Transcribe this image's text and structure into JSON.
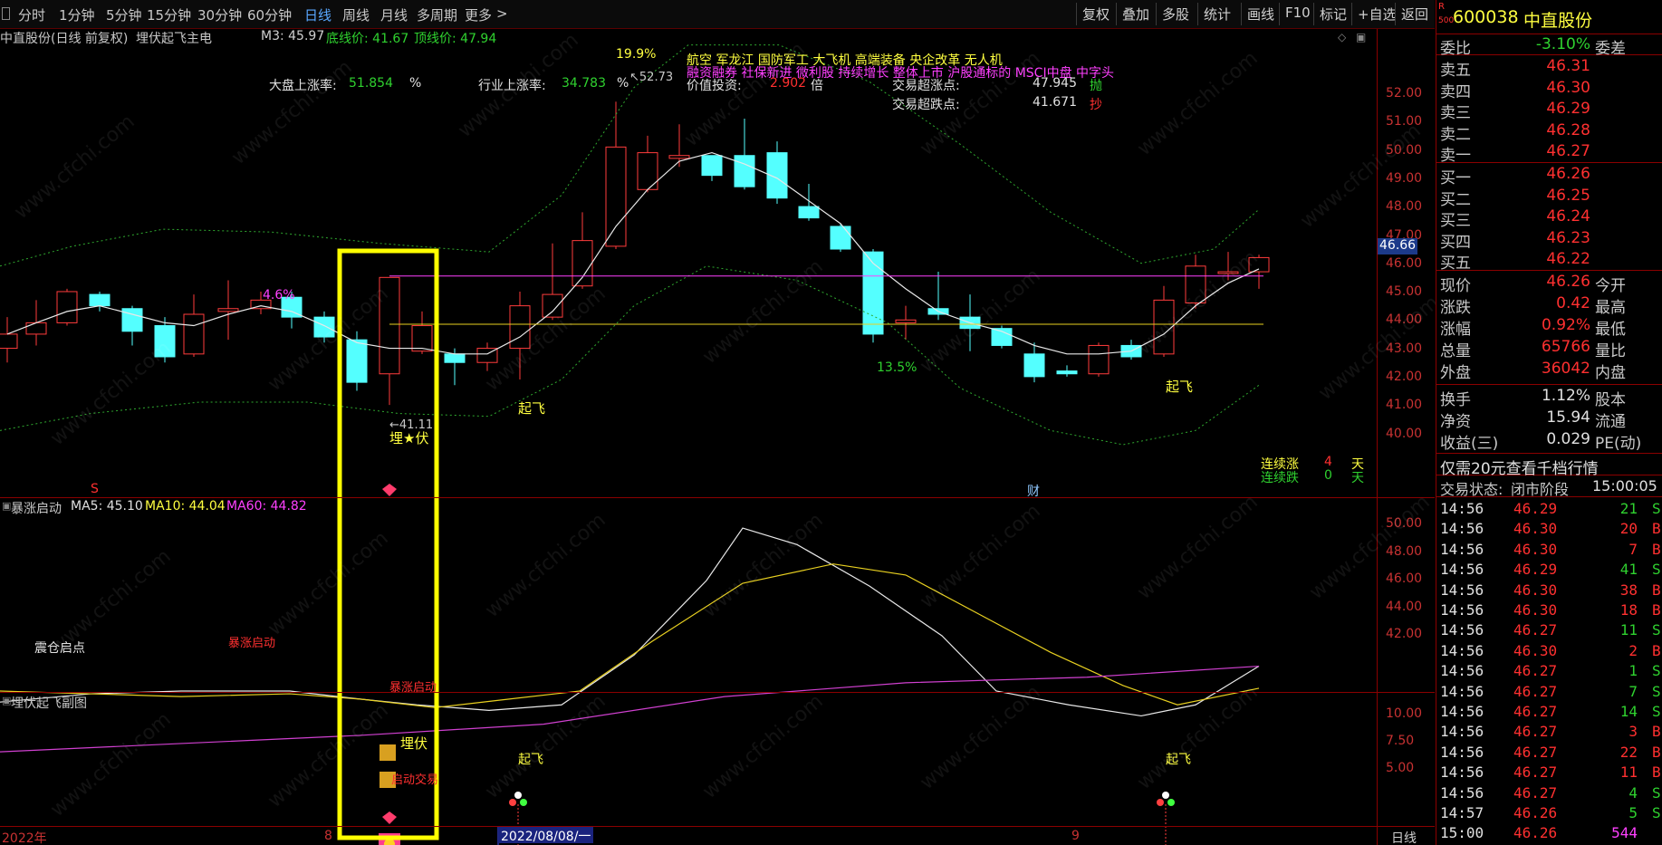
{
  "toolbar": {
    "periods": [
      "分时",
      "1分钟",
      "5分钟",
      "15分钟",
      "30分钟",
      "60分钟",
      "日线",
      "周线",
      "月线",
      "多周期",
      "更多"
    ],
    "active_period": "日线",
    "more_arrow": ">",
    "right_buttons": [
      "复权",
      "叠加",
      "多股",
      "统计",
      "画线",
      "F10",
      "标记",
      "+自选",
      "返回"
    ]
  },
  "main_header": {
    "stock_title": "中直股份(日线 前复权)",
    "indicator_name": "埋伏起飞主电",
    "m3": "M3: 45.97",
    "bottom_price": "底线价: 41.67",
    "top_price": "顶线价: 47.94"
  },
  "overlay": {
    "market_rise_label": "大盘上涨率:",
    "market_rise_value": "51.854",
    "market_rise_unit": "%",
    "industry_rise_label": "行业上涨率:",
    "industry_rise_value": "34.783",
    "industry_rise_unit": "%",
    "concept_line1": "航空     军龙江     国防军工 大飞机 高端装备 央企改革 无人机",
    "concept_line2": "融资融券 社保新进 微利股 持续增长 整体上市 沪股通标的 MSCI中盘 中字头",
    "value_invest_label": "价值投资:",
    "value_invest_value": "2.902",
    "value_invest_unit": "倍",
    "sell_point_label": "交易超涨点:",
    "sell_point_value": "47.945",
    "sell_point_tag": "抛",
    "buy_point_label": "交易超跌点:",
    "buy_point_value": "41.671",
    "buy_point_tag": "抄",
    "pct_19_9": "19.9%",
    "high_marker": "52.73",
    "pct_4_6": "4.6%",
    "pct_13_5": "13.5%",
    "low_marker": "41.11",
    "maifu_label": "埋★伏",
    "qifei_label_1": "起飞",
    "qifei_label_2": "起飞",
    "lianxu_zhang_label": "连续涨",
    "lianxu_zhang_value": "4",
    "lianxu_zhang_unit": "天",
    "lianxu_die_label": "连续跌",
    "lianxu_die_value": "0",
    "lianxu_die_unit": "天",
    "s_marker": "S",
    "cai_marker": "财",
    "current_price_tag": "46.66"
  },
  "main_axis": [
    "52.00",
    "51.00",
    "50.00",
    "49.00",
    "48.00",
    "47.00",
    "46.00",
    "45.00",
    "44.00",
    "43.00",
    "42.00",
    "41.00",
    "40.00"
  ],
  "sub1": {
    "name": "暴涨启动",
    "ma5": "MA5: 45.10",
    "ma10": "MA10: 44.04",
    "ma60": "MA60: 44.82",
    "label_zc": "震仓启点",
    "label_bz": "暴涨启动",
    "label_bz2": "暴涨启动",
    "axis": [
      "50.00",
      "48.00",
      "46.00",
      "44.00",
      "42.00"
    ]
  },
  "sub2": {
    "name": "埋伏起飞副图",
    "maifu": "埋伏",
    "qidong": "启动交易",
    "qifei1": "起飞",
    "qifei2": "起飞",
    "axis": [
      "10.00",
      "7.50",
      "5.00"
    ]
  },
  "date_axis": {
    "year": "2022年",
    "m8": "8",
    "cursor_date": "2022/08/08/一",
    "m9": "9",
    "period": "日线"
  },
  "watermark": "www.cfchi.com",
  "quote": {
    "code": "600038",
    "name": "中直股份",
    "r_label": "R",
    "r_sub": "500",
    "weibi_label": "委比",
    "weibi_value": "-3.10%",
    "weicha_label": "委差",
    "asks": [
      {
        "label": "卖五",
        "price": "46.31"
      },
      {
        "label": "卖四",
        "price": "46.30"
      },
      {
        "label": "卖三",
        "price": "46.29"
      },
      {
        "label": "卖二",
        "price": "46.28"
      },
      {
        "label": "卖一",
        "price": "46.27"
      }
    ],
    "bids": [
      {
        "label": "买一",
        "price": "46.26"
      },
      {
        "label": "买二",
        "price": "46.25"
      },
      {
        "label": "买三",
        "price": "46.24"
      },
      {
        "label": "买四",
        "price": "46.23"
      },
      {
        "label": "买五",
        "price": "46.22"
      }
    ],
    "stats": [
      {
        "l1": "现价",
        "v1": "46.26",
        "l2": "今开"
      },
      {
        "l1": "涨跌",
        "v1": "0.42",
        "l2": "最高"
      },
      {
        "l1": "涨幅",
        "v1": "0.92%",
        "l2": "最低"
      },
      {
        "l1": "总量",
        "v1": "65766",
        "l2": "量比"
      },
      {
        "l1": "外盘",
        "v1": "36042",
        "l2": "内盘"
      }
    ],
    "stats2": [
      {
        "l1": "换手",
        "v1": "1.12%",
        "l2": "股本"
      },
      {
        "l1": "净资",
        "v1": "15.94",
        "l2": "流通"
      },
      {
        "l1": "收益(三)",
        "v1": "0.029",
        "l2": "PE(动)"
      }
    ],
    "banner": "仅需20元查看千档行情",
    "trade_status_label": "交易状态:",
    "trade_status": "闭市阶段",
    "trade_time": "15:00:05",
    "ticks": [
      {
        "t": "14:56",
        "p": "46.29",
        "v": "21",
        "bs": "S"
      },
      {
        "t": "14:56",
        "p": "46.30",
        "v": "20",
        "bs": "B"
      },
      {
        "t": "14:56",
        "p": "46.30",
        "v": "7",
        "bs": "B"
      },
      {
        "t": "14:56",
        "p": "46.29",
        "v": "41",
        "bs": "S"
      },
      {
        "t": "14:56",
        "p": "46.30",
        "v": "38",
        "bs": "B"
      },
      {
        "t": "14:56",
        "p": "46.30",
        "v": "18",
        "bs": "B"
      },
      {
        "t": "14:56",
        "p": "46.27",
        "v": "11",
        "bs": "S"
      },
      {
        "t": "14:56",
        "p": "46.30",
        "v": "2",
        "bs": "B"
      },
      {
        "t": "14:56",
        "p": "46.27",
        "v": "1",
        "bs": "S"
      },
      {
        "t": "14:56",
        "p": "46.27",
        "v": "7",
        "bs": "S"
      },
      {
        "t": "14:56",
        "p": "46.27",
        "v": "14",
        "bs": "S"
      },
      {
        "t": "14:56",
        "p": "46.27",
        "v": "3",
        "bs": "B"
      },
      {
        "t": "14:56",
        "p": "46.27",
        "v": "22",
        "bs": "B"
      },
      {
        "t": "14:56",
        "p": "46.27",
        "v": "11",
        "bs": "B"
      },
      {
        "t": "14:56",
        "p": "46.27",
        "v": "4",
        "bs": "S"
      },
      {
        "t": "14:57",
        "p": "46.26",
        "v": "5",
        "bs": "S"
      },
      {
        "t": "15:00",
        "p": "46.26",
        "v": "544",
        "bs": ""
      }
    ]
  }
}
